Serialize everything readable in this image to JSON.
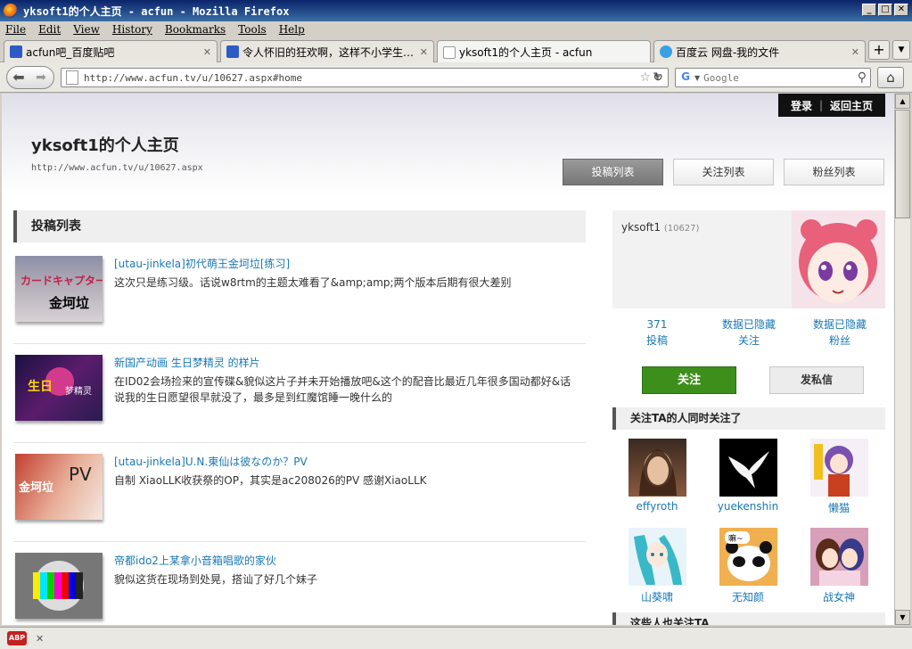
{
  "window": {
    "title": "yksoft1的个人主页 - acfun - Mozilla Firefox",
    "minimize": "_",
    "maximize": "□",
    "close": "✕"
  },
  "menu": [
    "File",
    "Edit",
    "View",
    "History",
    "Bookmarks",
    "Tools",
    "Help"
  ],
  "tabs": [
    {
      "label": "acfun吧_百度贴吧",
      "close": "✕"
    },
    {
      "label": "令人怀旧的狂欢啊，这样不小学生…",
      "close": "✕"
    },
    {
      "label": "yksoft1的个人主页 - acfun",
      "close": "✕"
    },
    {
      "label": "百度云 网盘-我的文件",
      "close": "✕"
    }
  ],
  "newtab": "+",
  "nav": {
    "back": "⬅",
    "forward": "➡",
    "url": "http://www.acfun.tv/u/10627.aspx#home",
    "reload": "↻",
    "search_engine": "G",
    "search_placeholder": "Google",
    "home": "⌂"
  },
  "page": {
    "topbar": {
      "login": "登录",
      "sep": "|",
      "back_home": "返回主页"
    },
    "title": "yksoft1的个人主页",
    "url": "http://www.acfun.tv/u/10627.aspx",
    "tabs": [
      "投稿列表",
      "关注列表",
      "粉丝列表"
    ],
    "section_title": "投稿列表",
    "posts": [
      {
        "title": "[utau-jinkela]初代萌王金坷垃[练习]",
        "desc": "这次只是练习级。话说w8rtm的主题太难看了&amp;amp;两个版本后期有很大差别"
      },
      {
        "title": "新国产动画 生日梦精灵 的样片",
        "desc": "在ID02会场捡来的宣传碟&貌似这片子并未开始播放吧&这个的配音比最近几年很多国动都好&话说我的生日愿望很早就没了，最多是到红魔馆睡一晚什么的"
      },
      {
        "title": "[utau-jinkela]U.N.東仙は彼なのか？PV",
        "desc": "自制 XiaoLLK收获祭的OP，其实是ac208026的PV 感谢XiaoLLK"
      },
      {
        "title": "帝都ido2上某拿小音箱唱歌的家伙",
        "desc": "貌似这货在现场到处晃，搭讪了好几个妹子"
      }
    ],
    "profile": {
      "name": "yksoft1",
      "uid": "(10627)",
      "stats": [
        {
          "value": "371",
          "label": "投稿"
        },
        {
          "value": "数据已隐藏",
          "label": "关注"
        },
        {
          "value": "数据已隐藏",
          "label": "粉丝"
        }
      ],
      "follow": "关注",
      "message": "发私信"
    },
    "also_follow_title": "关注TA的人同时关注了",
    "also_follow": [
      "effyroth",
      "yuekenshin",
      "懒猫",
      "山葵啸",
      "无知颜",
      "战女神"
    ],
    "followers_title": "这些人也关注TA"
  },
  "status": {
    "abp": "ABP",
    "close": "✕"
  }
}
